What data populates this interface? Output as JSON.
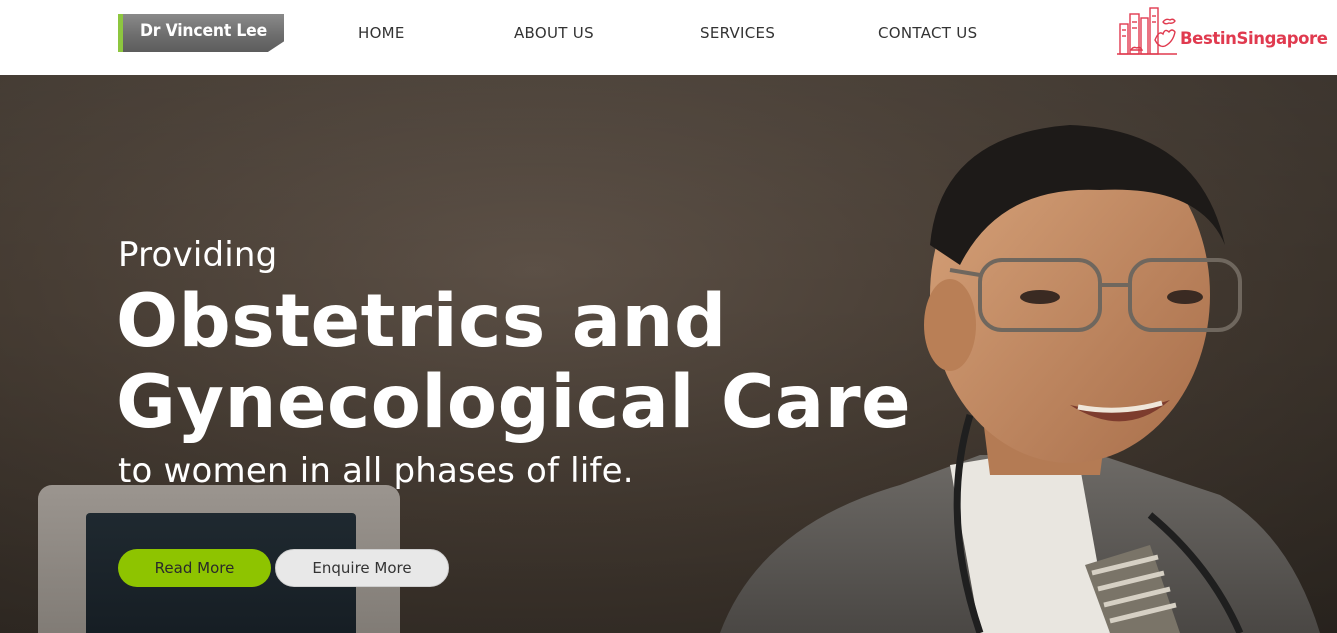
{
  "header": {
    "logo_text": "Dr Vincent Lee",
    "nav": [
      {
        "label": "HOME"
      },
      {
        "label": "ABOUT US"
      },
      {
        "label": "SERVICES"
      },
      {
        "label": "CONTACT US"
      }
    ],
    "badge": {
      "text": "BestinSingapore",
      "icon": "city-skyline-hand-icon",
      "color": "#e03a4f"
    }
  },
  "hero": {
    "pre_title": "Providing",
    "title_line1": "Obstetrics and",
    "title_line2": "Gynecological Care",
    "subtitle": "to women in all phases of life.",
    "buttons": {
      "read_more": "Read More",
      "enquire_more": "Enquire More"
    }
  },
  "colors": {
    "accent_green": "#8ec400",
    "logo_bar": "#8dc63f",
    "nav_text": "#333333",
    "button_secondary": "#e8e8e8"
  }
}
